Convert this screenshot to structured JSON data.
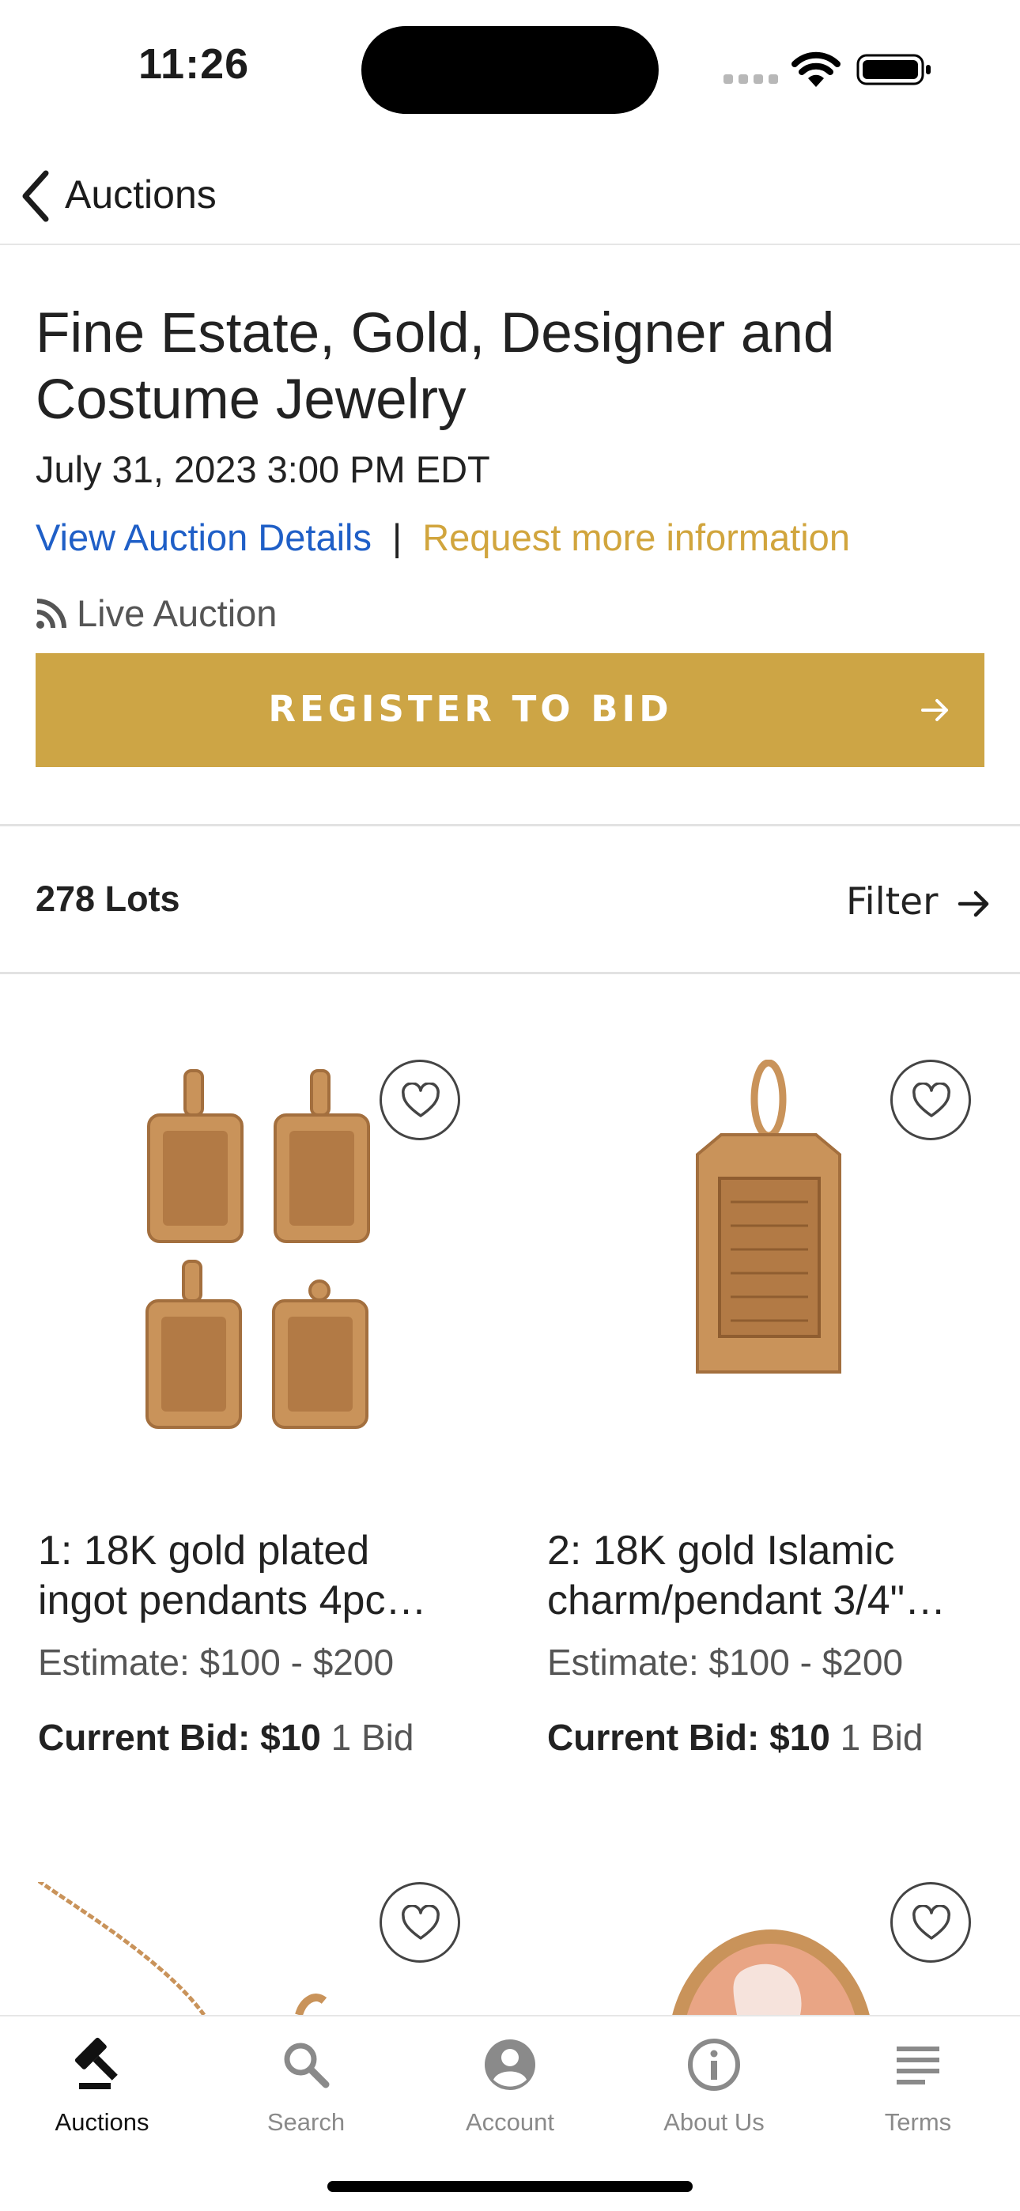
{
  "status": {
    "time": "11:26"
  },
  "nav": {
    "back_label": "Auctions"
  },
  "auction": {
    "title_line1": "Fine Estate, Gold, Designer and",
    "title_line2": "Costume Jewelry",
    "date": "July 31, 2023 3:00 PM EDT",
    "details_link": "View Auction Details",
    "separator": "|",
    "info_link": "Request more information",
    "type_label": "Live Auction",
    "register_label": "REGISTER TO BID"
  },
  "lots": {
    "count_label": "278 Lots",
    "filter_label": "Filter",
    "items": [
      {
        "title_line1": "1: 18K gold plated",
        "title_line2": "ingot pendants 4pc…",
        "estimate": "Estimate: $100 - $200",
        "bid_label": "Current Bid:",
        "bid_value": "$10",
        "bid_count": "1 Bid",
        "image": "gold-ingot-pendants"
      },
      {
        "title_line1": "2: 18K gold Islamic",
        "title_line2": "charm/pendant 3/4\"…",
        "estimate": "Estimate: $100 - $200",
        "bid_label": "Current Bid:",
        "bid_value": "$10",
        "bid_count": "1 Bid",
        "image": "gold-islamic-pendant"
      },
      {
        "image": "gold-chain-necklace"
      },
      {
        "image": "cameo-brooch"
      }
    ]
  },
  "tabs": [
    {
      "label": "Auctions",
      "icon": "gavel-icon",
      "active": true
    },
    {
      "label": "Search",
      "icon": "search-icon",
      "active": false
    },
    {
      "label": "Account",
      "icon": "account-icon",
      "active": false
    },
    {
      "label": "About Us",
      "icon": "info-icon",
      "active": false
    },
    {
      "label": "Terms",
      "icon": "terms-icon",
      "active": false
    }
  ],
  "colors": {
    "accent": "#cda545",
    "link_blue": "#1f5fc7",
    "link_gold": "#d1a53d",
    "gold_item": "#c9935a"
  }
}
